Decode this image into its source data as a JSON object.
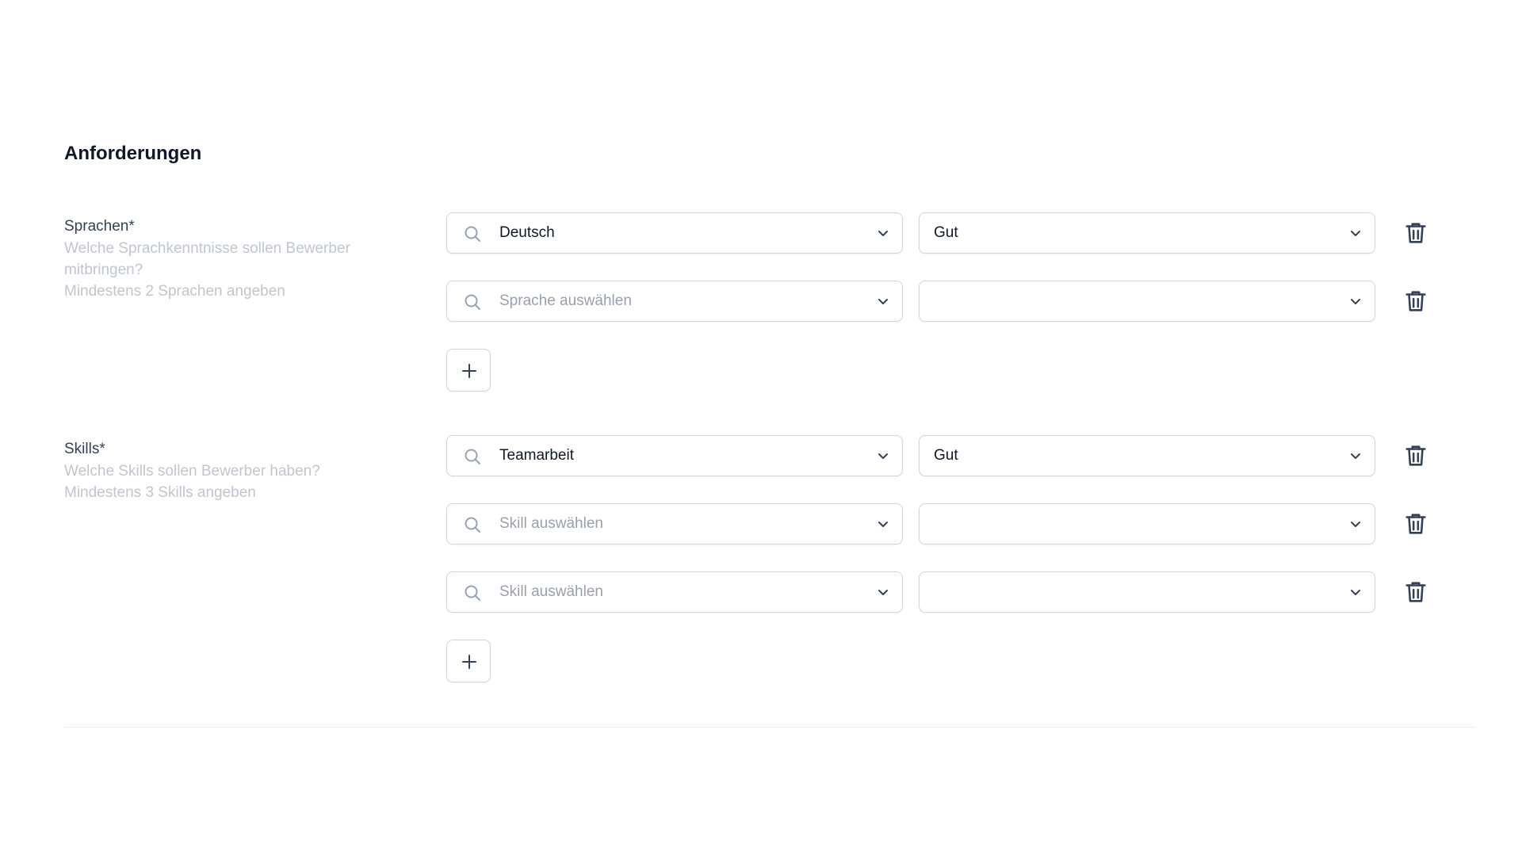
{
  "section": {
    "title": "Anforderungen"
  },
  "sprachen": {
    "label": "Sprachen*",
    "hint_line1": "Welche Sprachkenntnisse sollen Bewerber",
    "hint_line2": "mitbringen?",
    "hint_line3": "Mindestens 2 Sprachen angeben",
    "rows": [
      {
        "value": "Deutsch",
        "placeholder": "",
        "level": "Gut"
      },
      {
        "value": "",
        "placeholder": "Sprache auswählen",
        "level": ""
      }
    ],
    "add_label": "+"
  },
  "skills": {
    "label": "Skills*",
    "hint_line1": "Welche Skills sollen Bewerber haben?",
    "hint_line2": "Mindestens 3 Skills angeben",
    "rows": [
      {
        "value": "Teamarbeit",
        "placeholder": "",
        "level": "Gut"
      },
      {
        "value": "",
        "placeholder": "Skill auswählen",
        "level": ""
      },
      {
        "value": "",
        "placeholder": "Skill auswählen",
        "level": ""
      }
    ],
    "add_label": "+"
  },
  "icons": {
    "search": "search-icon",
    "chevron": "chevron-down-icon",
    "delete": "trash-icon",
    "add": "plus-icon"
  },
  "colors": {
    "text_primary": "#101828",
    "text_label": "#344054",
    "text_hint": "#c0c5ce",
    "placeholder": "#9aa0a9",
    "border": "#d0d5dd",
    "divider": "#eaecf0"
  }
}
